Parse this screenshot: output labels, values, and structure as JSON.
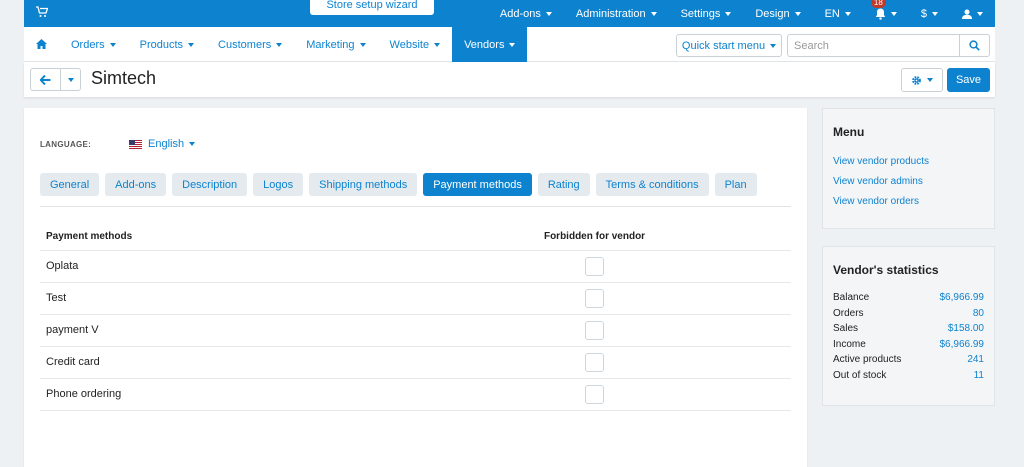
{
  "topbar": {
    "wizard_label": "Store setup wizard",
    "items": [
      {
        "label": "Add-ons",
        "caret": true
      },
      {
        "label": "Administration",
        "caret": true
      },
      {
        "label": "Settings",
        "caret": true
      },
      {
        "label": "Design",
        "caret": true
      },
      {
        "label": "EN",
        "caret": true
      }
    ],
    "notifications_badge": "18",
    "currency_label": "$"
  },
  "nav": {
    "items": [
      {
        "label": "Orders",
        "active": false
      },
      {
        "label": "Products",
        "active": false
      },
      {
        "label": "Customers",
        "active": false
      },
      {
        "label": "Marketing",
        "active": false
      },
      {
        "label": "Website",
        "active": false
      },
      {
        "label": "Vendors",
        "active": true
      }
    ],
    "quick_start_label": "Quick start menu",
    "search_placeholder": "Search"
  },
  "page": {
    "title": "Simtech",
    "save_label": "Save"
  },
  "language": {
    "label": "LANGUAGE:",
    "value": "English"
  },
  "tabs": [
    {
      "label": "General",
      "active": false
    },
    {
      "label": "Add-ons",
      "active": false
    },
    {
      "label": "Description",
      "active": false
    },
    {
      "label": "Logos",
      "active": false
    },
    {
      "label": "Shipping methods",
      "active": false
    },
    {
      "label": "Payment methods",
      "active": true
    },
    {
      "label": "Rating",
      "active": false
    },
    {
      "label": "Terms & conditions",
      "active": false
    },
    {
      "label": "Plan",
      "active": false
    }
  ],
  "payments_table": {
    "col_method": "Payment methods",
    "col_forbidden": "Forbidden for vendor",
    "rows": [
      {
        "name": "Oplata",
        "forbidden": false
      },
      {
        "name": "Test",
        "forbidden": false
      },
      {
        "name": "payment V",
        "forbidden": false
      },
      {
        "name": "Credit card",
        "forbidden": false
      },
      {
        "name": "Phone ordering",
        "forbidden": false
      }
    ]
  },
  "sidebar_menu": {
    "title": "Menu",
    "links": [
      "View vendor products",
      "View vendor admins",
      "View vendor orders"
    ]
  },
  "vendor_stats": {
    "title": "Vendor's statistics",
    "rows": [
      {
        "label": "Balance",
        "value": "$6,966.99"
      },
      {
        "label": "Orders",
        "value": "80"
      },
      {
        "label": "Sales",
        "value": "$158.00"
      },
      {
        "label": "Income",
        "value": "$6,966.99"
      },
      {
        "label": "Active products",
        "value": "241"
      },
      {
        "label": "Out of stock",
        "value": "11"
      }
    ]
  },
  "colors": {
    "accent": "#0d83d0",
    "badge": "#c0392b"
  },
  "icons": [
    "cart-icon",
    "bell-icon",
    "user-icon",
    "home-icon",
    "search-icon",
    "arrow-left-icon",
    "gear-icon",
    "us-flag-icon"
  ]
}
